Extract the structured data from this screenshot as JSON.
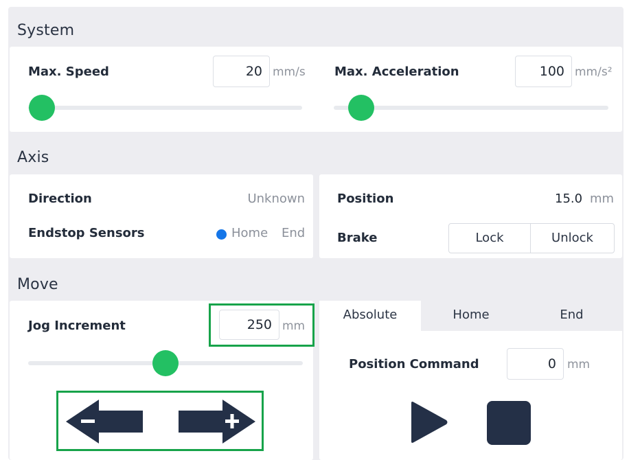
{
  "system": {
    "title": "System",
    "max_speed": {
      "label": "Max. Speed",
      "value": "20",
      "unit": "mm/s",
      "slider_fraction": 0.05
    },
    "max_acceleration": {
      "label": "Max. Acceleration",
      "value": "100",
      "unit": "mm/s²",
      "slider_fraction": 0.1
    }
  },
  "axis": {
    "title": "Axis",
    "direction": {
      "label": "Direction",
      "value": "Unknown"
    },
    "endstop": {
      "label": "Endstop Sensors",
      "home": "Home",
      "end": "End"
    },
    "position": {
      "label": "Position",
      "value": "15.0",
      "unit": "mm"
    },
    "brake": {
      "label": "Brake",
      "lock": "Lock",
      "unlock": "Unlock"
    }
  },
  "move": {
    "title": "Move",
    "jog": {
      "label": "Jog Increment",
      "value": "250",
      "unit": "mm",
      "slider_fraction": 0.5
    },
    "tabs": [
      "Absolute",
      "Home",
      "End"
    ],
    "active_tab": "Absolute",
    "position_command": {
      "label": "Position Command",
      "value": "0",
      "unit": "mm"
    }
  },
  "colors": {
    "accent_green": "#23c063",
    "highlight_green": "#17a34a",
    "dark_navy": "#243047",
    "radio_blue": "#1576e8"
  },
  "icons": [
    "jog-minus-arrow-icon",
    "jog-plus-arrow-icon",
    "play-icon",
    "stop-icon"
  ]
}
